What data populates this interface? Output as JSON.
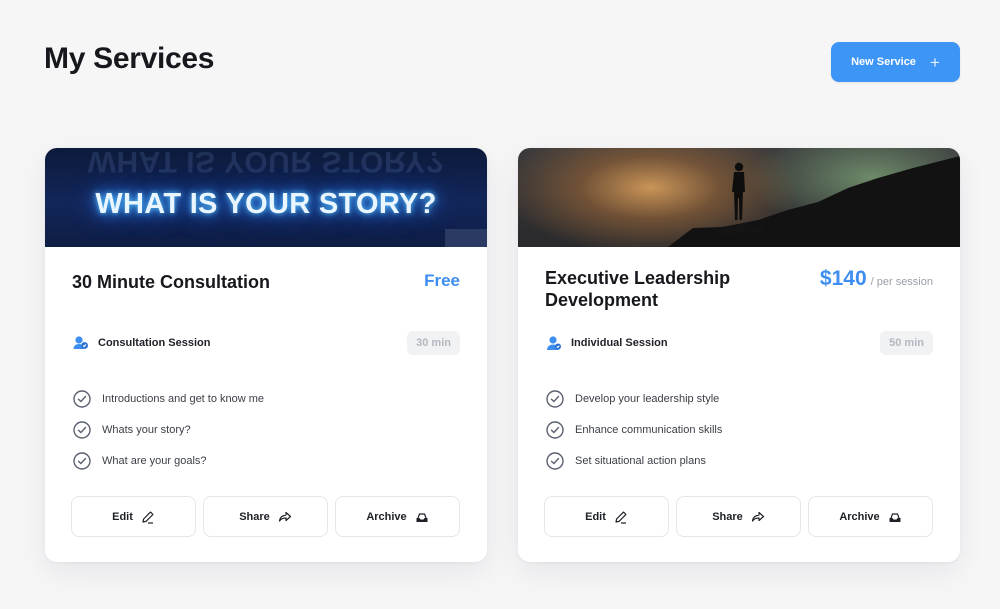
{
  "page": {
    "title": "My Services"
  },
  "header": {
    "new_service_label": "New Service",
    "new_service_icon": "plus-icon"
  },
  "colors": {
    "accent": "#3d95f5",
    "price": "#3d8ef0",
    "background": "#f6f6f7"
  },
  "services": [
    {
      "hero_text": "WHAT IS YOUR STORY?",
      "title": "30 Minute Consultation",
      "price": "Free",
      "price_unit": "",
      "session_type": "Consultation Session",
      "session_icon": "users-icon",
      "duration": "30 min",
      "features": [
        "Introductions and get to know me",
        "Whats your story?",
        "What are your goals?"
      ],
      "actions": {
        "edit": "Edit",
        "share": "Share",
        "archive": "Archive"
      }
    },
    {
      "hero_text": "",
      "title": "Executive Leadership Development",
      "price": "$140",
      "price_unit": "/ per session",
      "session_type": "Individual Session",
      "session_icon": "person-icon",
      "duration": "50 min",
      "features": [
        "Develop your leadership style",
        "Enhance communication skills",
        "Set situational action plans"
      ],
      "actions": {
        "edit": "Edit",
        "share": "Share",
        "archive": "Archive"
      }
    }
  ]
}
